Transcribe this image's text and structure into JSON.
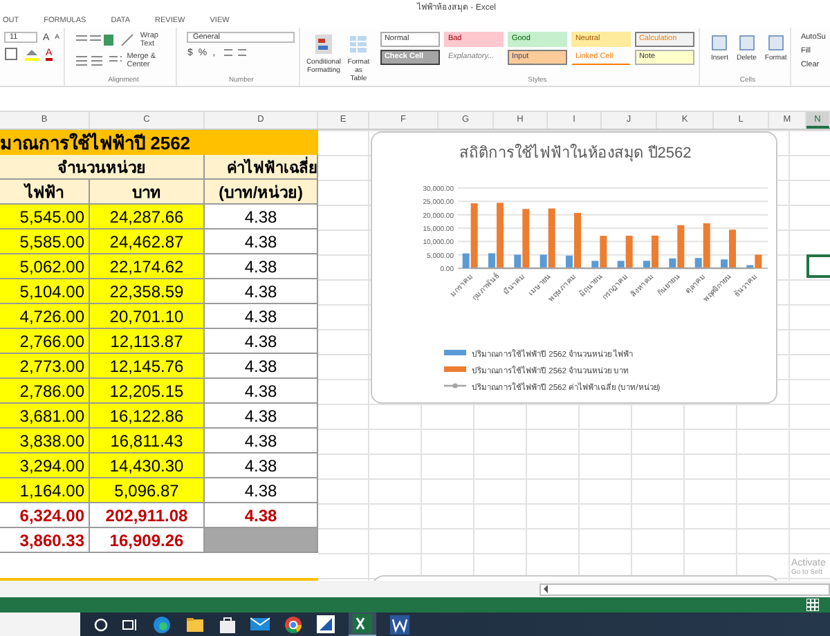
{
  "window": {
    "title": "ไฟฟ้าห้องสมุด - Excel"
  },
  "ribbon_tabs": [
    "OUT",
    "FORMULAS",
    "DATA",
    "REVIEW",
    "VIEW"
  ],
  "ribbon": {
    "font_size": "11",
    "grow": "A",
    "shrink": "A",
    "font_color": "A",
    "wrap": "Wrap Text",
    "merge": "Merge & Center",
    "alignment_label": "Alignment",
    "number_format": "General",
    "currency": "$",
    "percent": "%",
    "comma": ",",
    "number_label": "Number",
    "conditional": "Conditional Formatting",
    "format_table": "Format as Table",
    "styles": [
      {
        "label": "Normal",
        "kind": "normal"
      },
      {
        "label": "Bad",
        "kind": "bad"
      },
      {
        "label": "Good",
        "kind": "good"
      },
      {
        "label": "Neutral",
        "kind": "neutral"
      },
      {
        "label": "Calculation",
        "kind": "calculation"
      },
      {
        "label": "Check Cell",
        "kind": "check"
      },
      {
        "label": "Explanatory...",
        "kind": "explanatory"
      },
      {
        "label": "Input",
        "kind": "input"
      },
      {
        "label": "Linked Cell",
        "kind": "linked"
      },
      {
        "label": "Note",
        "kind": "note"
      }
    ],
    "styles_label": "Styles",
    "cells": [
      "Insert",
      "Delete",
      "Format"
    ],
    "cells_label": "Cells",
    "editing": [
      "AutoSu",
      "Fill",
      "Clear"
    ]
  },
  "sheet": {
    "columns": [
      {
        "label": "B",
        "selected": false
      },
      {
        "label": "C",
        "selected": false
      },
      {
        "label": "D",
        "selected": false
      },
      {
        "label": "E",
        "selected": false
      },
      {
        "label": "F",
        "selected": false
      },
      {
        "label": "G",
        "selected": false
      },
      {
        "label": "H",
        "selected": false
      },
      {
        "label": "I",
        "selected": false
      },
      {
        "label": "J",
        "selected": false
      },
      {
        "label": "K",
        "selected": false
      },
      {
        "label": "L",
        "selected": false
      },
      {
        "label": "M",
        "selected": false
      },
      {
        "label": "N",
        "selected": true
      }
    ],
    "title": "มาณการใช้ไฟฟ้าปี 2562",
    "group_header": "จำนวนหน่วย",
    "avg_header": "ค่าไฟฟ้าเฉลี่ย",
    "col_b": "ไฟฟ้า",
    "col_c": "บาท",
    "col_d": "(บาท/หน่วย)",
    "rows": [
      [
        "5,545.00",
        "24,287.66",
        "4.38"
      ],
      [
        "5,585.00",
        "24,462.87",
        "4.38"
      ],
      [
        "5,062.00",
        "22,174.62",
        "4.38"
      ],
      [
        "5,104.00",
        "22,358.59",
        "4.38"
      ],
      [
        "4,726.00",
        "20,701.10",
        "4.38"
      ],
      [
        "2,766.00",
        "12,113.87",
        "4.38"
      ],
      [
        "2,773.00",
        "12,145.76",
        "4.38"
      ],
      [
        "2,786.00",
        "12,205.15",
        "4.38"
      ],
      [
        "3,681.00",
        "16,122.86",
        "4.38"
      ],
      [
        "3,838.00",
        "16,811.43",
        "4.38"
      ],
      [
        "3,294.00",
        "14,430.30",
        "4.38"
      ],
      [
        "1,164.00",
        "5,096.87",
        "4.38"
      ]
    ],
    "total": [
      "6,324.00",
      "202,911.08",
      "4.38"
    ],
    "average": [
      "3,860.33",
      "16,909.26"
    ]
  },
  "chart": {
    "chart_data": {
      "type": "bar",
      "title": "สถิติการใช้ไฟฟ้าในห้องสมุด ปี2562",
      "categories": [
        "มกราคม",
        "กุมภาพันธ์",
        "มีนาคม",
        "เมษายน",
        "พฤษภาคม",
        "มิถุนายน",
        "กรกฎาคม",
        "สิงหาคม",
        "กันยายน",
        "ตุลาคม",
        "พฤศจิกายน",
        "ธันวาคม"
      ],
      "ylim": [
        0,
        30000
      ],
      "grid": true,
      "legend": true,
      "yticks": [
        {
          "value": 0,
          "label": "0.00"
        },
        {
          "value": 5000,
          "label": "5,000.00"
        },
        {
          "value": 10000,
          "label": "10,000.00"
        },
        {
          "value": 15000,
          "label": "15,000.00"
        },
        {
          "value": 20000,
          "label": "20,000.00"
        },
        {
          "value": 25000,
          "label": "25,000.00"
        },
        {
          "value": 30000,
          "label": "30,000.00"
        }
      ],
      "series": [
        {
          "name": "ปริมาณการใช้ไฟฟ้าปี 2562 จำนวนหน่วย ไฟฟ้า",
          "color": "#5b9bd5",
          "values": [
            5545,
            5585,
            5062,
            5104,
            4726,
            2766,
            2773,
            2786,
            3681,
            3838,
            3294,
            1164
          ]
        },
        {
          "name": "ปริมาณการใช้ไฟฟ้าปี 2562 จำนวนหน่วย บาท",
          "color": "#ed7d31",
          "values": [
            24288,
            24463,
            22175,
            22359,
            20701,
            12114,
            12146,
            12205,
            16123,
            16811,
            14430,
            5097
          ]
        },
        {
          "name": "ปริมาณการใช้ไฟฟ้าปี 2562 ค่าไฟฟ้าเฉลี่ย (บาท/หน่วย)",
          "color": "#a5a5a5",
          "type": "line",
          "values": [
            4.38,
            4.38,
            4.38,
            4.38,
            4.38,
            4.38,
            4.38,
            4.38,
            4.38,
            4.38,
            4.38,
            4.38
          ]
        }
      ]
    }
  },
  "activation": {
    "title": "Activate",
    "subtitle": "Go to Sett"
  }
}
